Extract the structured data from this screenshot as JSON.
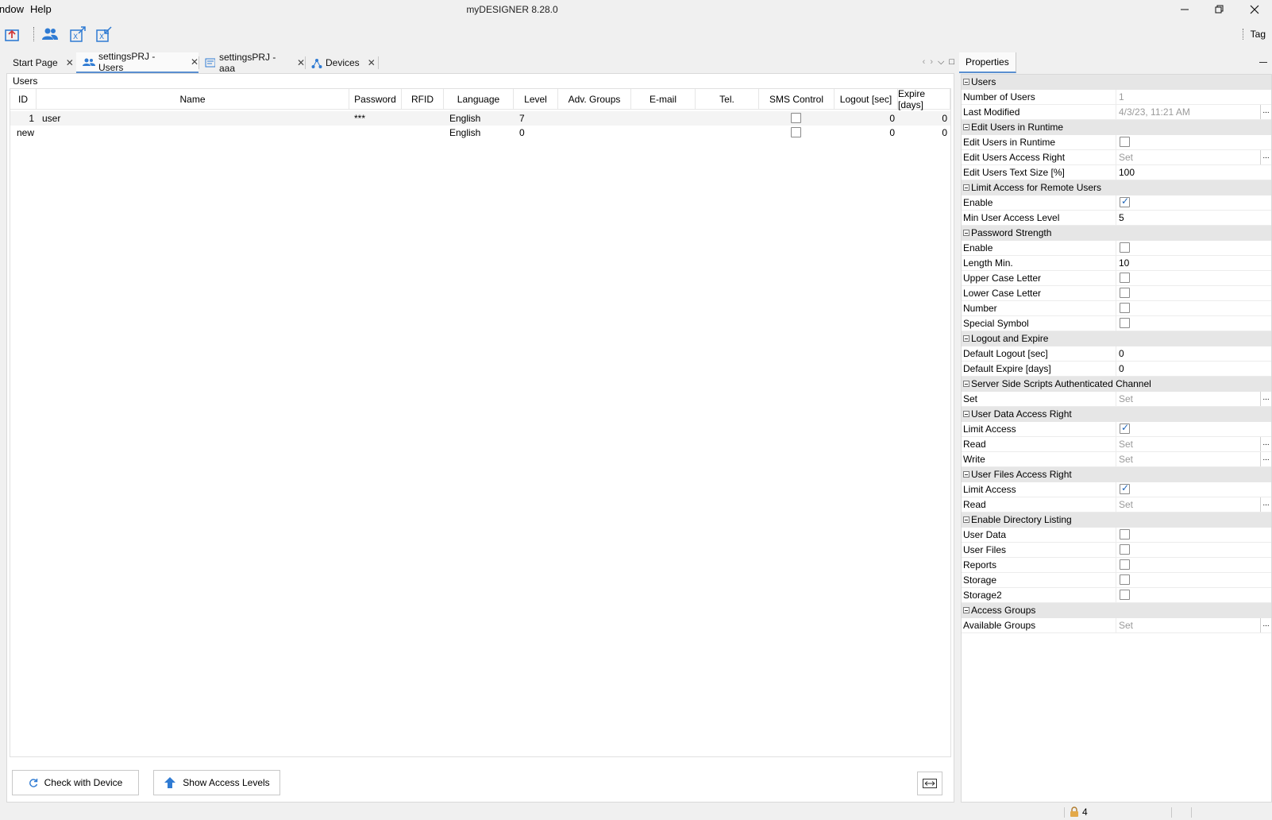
{
  "menu": {
    "items": [
      "indow",
      "Help"
    ]
  },
  "window": {
    "title": "myDESIGNER 8.28.0"
  },
  "toolbar": {
    "tag_label": "Tag"
  },
  "tabs": [
    {
      "label": "Start Page"
    },
    {
      "label": "settingsPRJ - Users"
    },
    {
      "label": "settingsPRJ - aaa"
    },
    {
      "label": "Devices"
    }
  ],
  "users_panel": {
    "group_label": "Users",
    "columns": [
      "ID",
      "Name",
      "Password",
      "RFID",
      "Language",
      "Level",
      "Adv. Groups",
      "E-mail",
      "Tel.",
      "SMS Control",
      "Logout [sec]",
      "Expire [days]"
    ],
    "rows": [
      {
        "id": "1",
        "name": "user",
        "password": "***",
        "rfid": "",
        "language": "English",
        "level": "7",
        "sms": false,
        "logout": "0",
        "expire": "0"
      },
      {
        "id": "new",
        "name": "",
        "password": "",
        "rfid": "",
        "language": "English",
        "level": "0",
        "sms": false,
        "logout": "0",
        "expire": "0"
      }
    ],
    "check_button": "Check with Device",
    "access_button": "Show Access Levels"
  },
  "properties": {
    "title": "Properties",
    "rows": [
      {
        "kind": "cat",
        "label": "Users"
      },
      {
        "kind": "text",
        "label": "Number of Users",
        "value": "1",
        "dim": true
      },
      {
        "kind": "text",
        "label": "Last Modified",
        "value": "4/3/23, 11:21 AM",
        "dim": true,
        "dots": true
      },
      {
        "kind": "cat",
        "label": "Edit Users in Runtime"
      },
      {
        "kind": "check",
        "label": "Edit Users in Runtime",
        "checked": false
      },
      {
        "kind": "text",
        "label": "Edit Users Access Right",
        "value": "Set",
        "dim": true,
        "dots": true
      },
      {
        "kind": "text",
        "label": "Edit Users Text Size [%]",
        "value": "100"
      },
      {
        "kind": "cat",
        "label": "Limit Access for Remote Users"
      },
      {
        "kind": "check",
        "label": "Enable",
        "checked": true
      },
      {
        "kind": "text",
        "label": "Min User Access Level",
        "value": "5"
      },
      {
        "kind": "cat",
        "label": "Password Strength"
      },
      {
        "kind": "check",
        "label": "Enable",
        "checked": false
      },
      {
        "kind": "text",
        "label": "Length Min.",
        "value": "10"
      },
      {
        "kind": "check",
        "label": "Upper Case Letter",
        "checked": false
      },
      {
        "kind": "check",
        "label": "Lower Case Letter",
        "checked": false
      },
      {
        "kind": "check",
        "label": "Number",
        "checked": false
      },
      {
        "kind": "check",
        "label": "Special Symbol",
        "checked": false
      },
      {
        "kind": "cat",
        "label": "Logout and Expire"
      },
      {
        "kind": "text",
        "label": "Default Logout [sec]",
        "value": "0"
      },
      {
        "kind": "text",
        "label": "Default Expire [days]",
        "value": "0"
      },
      {
        "kind": "cat",
        "label": "Server Side Scripts Authenticated Channel"
      },
      {
        "kind": "text",
        "label": "Set",
        "value": "Set",
        "dim": true,
        "dots": true
      },
      {
        "kind": "cat",
        "label": "User Data Access Right"
      },
      {
        "kind": "check",
        "label": "Limit Access",
        "checked": true
      },
      {
        "kind": "text",
        "label": "Read",
        "value": "Set",
        "dim": true,
        "dots": true
      },
      {
        "kind": "text",
        "label": "Write",
        "value": "Set",
        "dim": true,
        "dots": true
      },
      {
        "kind": "cat",
        "label": "User Files Access Right"
      },
      {
        "kind": "check",
        "label": "Limit Access",
        "checked": true
      },
      {
        "kind": "text",
        "label": "Read",
        "value": "Set",
        "dim": true,
        "dots": true
      },
      {
        "kind": "cat",
        "label": "Enable Directory Listing"
      },
      {
        "kind": "check",
        "label": "User Data",
        "checked": false
      },
      {
        "kind": "check",
        "label": "User Files",
        "checked": false
      },
      {
        "kind": "check",
        "label": "Reports",
        "checked": false
      },
      {
        "kind": "check",
        "label": "Storage",
        "checked": false
      },
      {
        "kind": "check",
        "label": "Storage2",
        "checked": false
      },
      {
        "kind": "cat",
        "label": "Access Groups"
      },
      {
        "kind": "text",
        "label": "Available Groups",
        "value": "Set",
        "dim": true,
        "dots": true
      }
    ]
  },
  "status": {
    "lock_count": "4"
  },
  "colors": {
    "accent": "#5a8fd0",
    "icon_blue": "#2f7bd3",
    "check_blue": "#1d64b7"
  }
}
